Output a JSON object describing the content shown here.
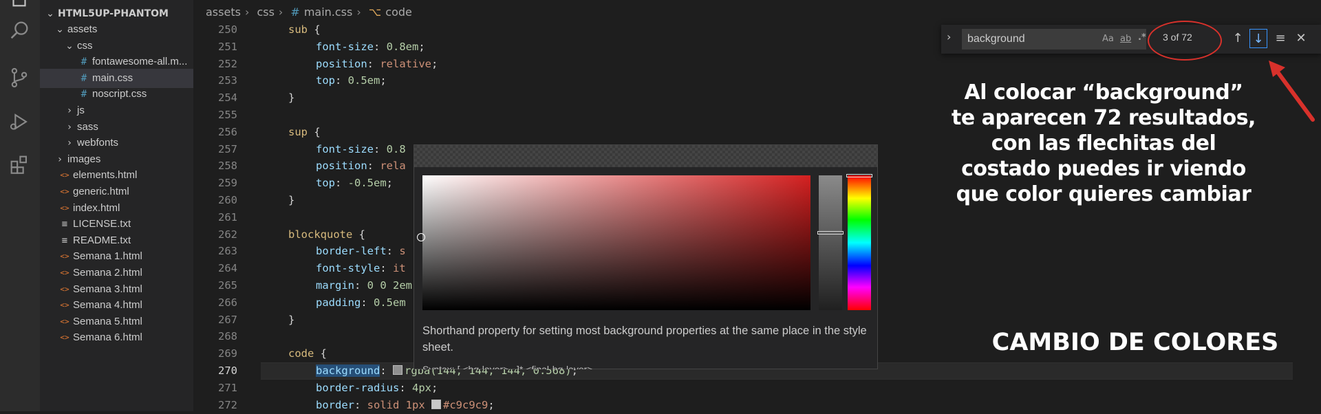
{
  "explorer": {
    "root_label": "HTML5UP-PHANTOM",
    "items": [
      {
        "label": "assets",
        "type": "folder-open",
        "indent": 1
      },
      {
        "label": "css",
        "type": "folder-open",
        "indent": 2
      },
      {
        "label": "fontawesome-all.m...",
        "type": "css",
        "indent": 3
      },
      {
        "label": "main.css",
        "type": "css",
        "indent": 3,
        "selected": true
      },
      {
        "label": "noscript.css",
        "type": "css",
        "indent": 3
      },
      {
        "label": "js",
        "type": "folder",
        "indent": 2
      },
      {
        "label": "sass",
        "type": "folder",
        "indent": 2
      },
      {
        "label": "webfonts",
        "type": "folder",
        "indent": 2
      },
      {
        "label": "images",
        "type": "folder",
        "indent": 1
      },
      {
        "label": "elements.html",
        "type": "html",
        "indent": 1
      },
      {
        "label": "generic.html",
        "type": "html",
        "indent": 1
      },
      {
        "label": "index.html",
        "type": "html",
        "indent": 1
      },
      {
        "label": "LICENSE.txt",
        "type": "txt",
        "indent": 1
      },
      {
        "label": "README.txt",
        "type": "txt",
        "indent": 1
      },
      {
        "label": "Semana 1.html",
        "type": "html",
        "indent": 1
      },
      {
        "label": "Semana 2.html",
        "type": "html",
        "indent": 1
      },
      {
        "label": "Semana 3.html",
        "type": "html",
        "indent": 1
      },
      {
        "label": "Semana 4.html",
        "type": "html",
        "indent": 1
      },
      {
        "label": "Semana 5.html",
        "type": "html",
        "indent": 1
      },
      {
        "label": "Semana 6.html",
        "type": "html",
        "indent": 1
      }
    ]
  },
  "breadcrumb": {
    "parts": [
      "assets",
      "css",
      "main.css",
      "code"
    ],
    "hash": "#"
  },
  "code": {
    "active_line": 270,
    "lines": [
      {
        "n": 250,
        "tokens": [
          {
            "t": "sub ",
            "c": "sel-kw"
          },
          {
            "t": "{",
            "c": "punc"
          }
        ],
        "indent": 0
      },
      {
        "n": 251,
        "tokens": [
          {
            "t": "font-size",
            "c": "prop"
          },
          {
            "t": ": ",
            "c": "punc"
          },
          {
            "t": "0.8em",
            "c": "num"
          },
          {
            "t": ";",
            "c": "punc"
          }
        ],
        "indent": 1
      },
      {
        "n": 252,
        "tokens": [
          {
            "t": "position",
            "c": "prop"
          },
          {
            "t": ": ",
            "c": "punc"
          },
          {
            "t": "relative",
            "c": "val"
          },
          {
            "t": ";",
            "c": "punc"
          }
        ],
        "indent": 1
      },
      {
        "n": 253,
        "tokens": [
          {
            "t": "top",
            "c": "prop"
          },
          {
            "t": ": ",
            "c": "punc"
          },
          {
            "t": "0.5em",
            "c": "num"
          },
          {
            "t": ";",
            "c": "punc"
          }
        ],
        "indent": 1
      },
      {
        "n": 254,
        "tokens": [
          {
            "t": "}",
            "c": "punc"
          }
        ],
        "indent": 0
      },
      {
        "n": 255,
        "tokens": [],
        "indent": 0
      },
      {
        "n": 256,
        "tokens": [
          {
            "t": "sup ",
            "c": "sel-kw"
          },
          {
            "t": "{",
            "c": "punc"
          }
        ],
        "indent": 0
      },
      {
        "n": 257,
        "tokens": [
          {
            "t": "font-size",
            "c": "prop"
          },
          {
            "t": ": ",
            "c": "punc"
          },
          {
            "t": "0.8",
            "c": "num"
          }
        ],
        "indent": 1
      },
      {
        "n": 258,
        "tokens": [
          {
            "t": "position",
            "c": "prop"
          },
          {
            "t": ": ",
            "c": "punc"
          },
          {
            "t": "rela",
            "c": "val"
          }
        ],
        "indent": 1
      },
      {
        "n": 259,
        "tokens": [
          {
            "t": "top",
            "c": "prop"
          },
          {
            "t": ": ",
            "c": "punc"
          },
          {
            "t": "-0.5em",
            "c": "num"
          },
          {
            "t": ";",
            "c": "punc"
          }
        ],
        "indent": 1
      },
      {
        "n": 260,
        "tokens": [
          {
            "t": "}",
            "c": "punc"
          }
        ],
        "indent": 0
      },
      {
        "n": 261,
        "tokens": [],
        "indent": 0
      },
      {
        "n": 262,
        "tokens": [
          {
            "t": "blockquote ",
            "c": "sel-kw"
          },
          {
            "t": "{",
            "c": "punc"
          }
        ],
        "indent": 0
      },
      {
        "n": 263,
        "tokens": [
          {
            "t": "border-left",
            "c": "prop"
          },
          {
            "t": ": ",
            "c": "punc"
          },
          {
            "t": "s",
            "c": "val"
          }
        ],
        "indent": 1
      },
      {
        "n": 264,
        "tokens": [
          {
            "t": "font-style",
            "c": "prop"
          },
          {
            "t": ": ",
            "c": "punc"
          },
          {
            "t": "it",
            "c": "val"
          }
        ],
        "indent": 1
      },
      {
        "n": 265,
        "tokens": [
          {
            "t": "margin",
            "c": "prop"
          },
          {
            "t": ": ",
            "c": "punc"
          },
          {
            "t": "0 0 2em",
            "c": "num"
          }
        ],
        "indent": 1
      },
      {
        "n": 266,
        "tokens": [
          {
            "t": "padding",
            "c": "prop"
          },
          {
            "t": ": ",
            "c": "punc"
          },
          {
            "t": "0.5em",
            "c": "num"
          }
        ],
        "indent": 1
      },
      {
        "n": 267,
        "tokens": [
          {
            "t": "}",
            "c": "punc"
          }
        ],
        "indent": 0
      },
      {
        "n": 268,
        "tokens": [],
        "indent": 0
      },
      {
        "n": 269,
        "tokens": [
          {
            "t": "code ",
            "c": "sel-kw"
          },
          {
            "t": "{",
            "c": "punc"
          }
        ],
        "indent": 0
      },
      {
        "n": 270,
        "tokens": [
          {
            "t": "background",
            "c": "prop match-hl"
          },
          {
            "t": ": ",
            "c": "punc"
          },
          {
            "t": "SWATCH:#909090",
            "c": "swatch"
          },
          {
            "t": "rgba(144, 144, 144, 0.568)",
            "c": "num"
          },
          {
            "t": ";",
            "c": "punc"
          }
        ],
        "indent": 1
      },
      {
        "n": 271,
        "tokens": [
          {
            "t": "border-radius",
            "c": "prop"
          },
          {
            "t": ": ",
            "c": "punc"
          },
          {
            "t": "4px",
            "c": "num"
          },
          {
            "t": ";",
            "c": "punc"
          }
        ],
        "indent": 1
      },
      {
        "n": 272,
        "tokens": [
          {
            "t": "border",
            "c": "prop"
          },
          {
            "t": ": ",
            "c": "punc"
          },
          {
            "t": "solid 1px ",
            "c": "val"
          },
          {
            "t": "SWATCH:#c9c9c9",
            "c": "swatch"
          },
          {
            "t": "#c9c9c9",
            "c": "val"
          },
          {
            "t": ";",
            "c": "punc"
          }
        ],
        "indent": 1
      }
    ]
  },
  "find": {
    "value": "background",
    "count": "3 of 72",
    "opt_case": "Aa",
    "opt_word": "ab",
    "opt_regex": ".*"
  },
  "picker": {
    "description": "Shorthand property for setting most background properties at the same place in the style sheet.",
    "syntax": "Syntax: [ <bg-layer> , ]* <final-bg-layer>"
  },
  "annotation": {
    "text_lines": [
      "Al colocar “background”",
      "te aparecen 72 resultados,",
      "con las flechitas del",
      "costado puedes ir viendo",
      "que color quieres cambiar"
    ],
    "title": "CAMBIO DE COLORES"
  },
  "colors": {
    "accent": "#3794ff",
    "annotation_red": "#d8312b",
    "css_icon": "#519aba",
    "html_icon": "#e37933"
  }
}
